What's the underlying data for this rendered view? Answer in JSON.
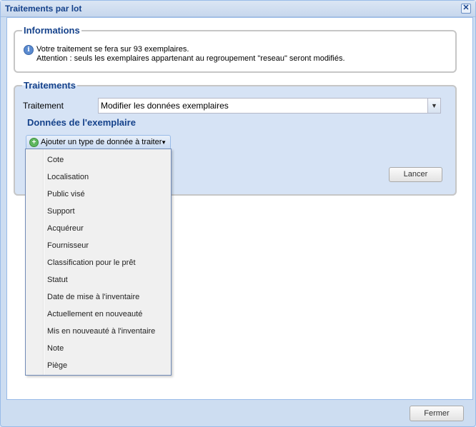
{
  "window": {
    "title": "Traitements par lot",
    "close_glyph": "✕"
  },
  "info": {
    "legend": "Informations",
    "icon": "info-icon",
    "line1": "Votre traitement se fera sur 93 exemplaires.",
    "line2": "Attention : seuls les exemplaires appartenant au regroupement \"reseau\" seront modifiés."
  },
  "traitements": {
    "legend": "Traitements",
    "traitement_label": "Traitement",
    "traitement_value": "Modifier les données exemplaires",
    "subsection_title": "Données de l'exemplaire",
    "add_type_label": "Ajouter un type de donnée à traiter",
    "lancer_label": "Lancer"
  },
  "menu": {
    "items": [
      "Cote",
      "Localisation",
      "Public visé",
      "Support",
      "Acquéreur",
      "Fournisseur",
      "Classification pour le prêt",
      "Statut",
      "Date de mise à l'inventaire",
      "Actuellement en nouveauté",
      "Mis en nouveauté à l'inventaire",
      "Note",
      "Piège"
    ]
  },
  "footer": {
    "fermer_label": "Fermer"
  }
}
